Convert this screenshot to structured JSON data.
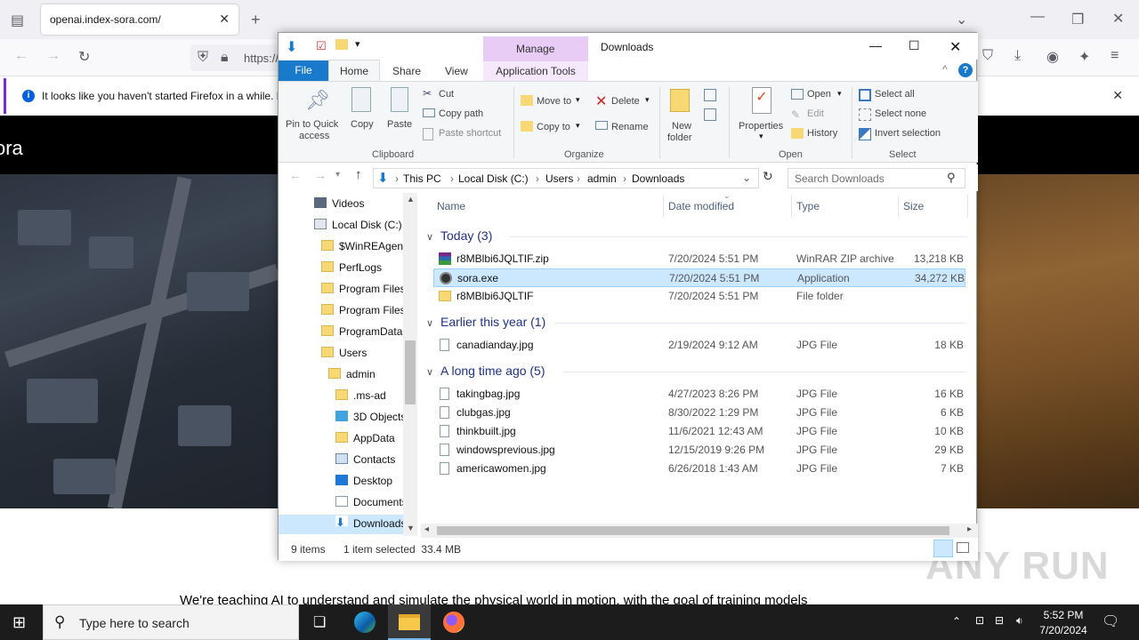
{
  "browser": {
    "tab_title": "openai.index-sora.com/",
    "url_text": "https://",
    "notification": "It looks like you haven't started Firefox in a while. D"
  },
  "page": {
    "logo": "ora",
    "body_text": "We're teaching AI to understand and simulate the physical world in motion, with the goal of training models",
    "watermark": "ANY RUN"
  },
  "explorer": {
    "window_title": "Downloads",
    "manage_label": "Manage",
    "tabs": {
      "file": "File",
      "home": "Home",
      "share": "Share",
      "view": "View",
      "app_tools": "Application Tools"
    },
    "ribbon": {
      "pin": "Pin to Quick access",
      "pin_line1": "Pin to Quick",
      "pin_line2": "access",
      "copy": "Copy",
      "paste": "Paste",
      "cut": "Cut",
      "copy_path": "Copy path",
      "paste_shortcut": "Paste shortcut",
      "move_to": "Move to",
      "copy_to": "Copy to",
      "delete": "Delete",
      "rename": "Rename",
      "new_folder_line1": "New",
      "new_folder_line2": "folder",
      "properties": "Properties",
      "open": "Open",
      "edit": "Edit",
      "history": "History",
      "select_all": "Select all",
      "select_none": "Select none",
      "invert_selection": "Invert selection",
      "groups": {
        "clipboard": "Clipboard",
        "organize": "Organize",
        "open": "Open",
        "select": "Select"
      }
    },
    "address": [
      "This PC",
      "Local Disk (C:)",
      "Users",
      "admin",
      "Downloads"
    ],
    "search_placeholder": "Search Downloads",
    "nav_items": [
      {
        "label": "Videos",
        "icon": "videos-icon"
      },
      {
        "label": "Local Disk (C:)",
        "icon": "drive-icon"
      },
      {
        "label": "$WinREAgent",
        "icon": "folder-icon"
      },
      {
        "label": "PerfLogs",
        "icon": "folder-icon"
      },
      {
        "label": "Program Files",
        "icon": "folder-icon"
      },
      {
        "label": "Program Files",
        "icon": "folder-icon"
      },
      {
        "label": "ProgramData",
        "icon": "folder-icon"
      },
      {
        "label": "Users",
        "icon": "folder-icon"
      },
      {
        "label": "admin",
        "icon": "folder-icon"
      },
      {
        "label": ".ms-ad",
        "icon": "folder-icon"
      },
      {
        "label": "3D Objects",
        "icon": "3d-objects-icon"
      },
      {
        "label": "AppData",
        "icon": "folder-icon"
      },
      {
        "label": "Contacts",
        "icon": "contacts-icon"
      },
      {
        "label": "Desktop",
        "icon": "desktop-icon"
      },
      {
        "label": "Documents",
        "icon": "documents-icon"
      },
      {
        "label": "Downloads",
        "icon": "downloads-icon"
      }
    ],
    "columns": {
      "name": "Name",
      "date": "Date modified",
      "type": "Type",
      "size": "Size"
    },
    "groups": [
      {
        "title": "Today (3)",
        "files": [
          {
            "name": "r8MBlbi6JQLTIF.zip",
            "date": "7/20/2024 5:51 PM",
            "type": "WinRAR ZIP archive",
            "size": "13,218 KB",
            "icon": "winrar-icon"
          },
          {
            "name": "sora.exe",
            "date": "7/20/2024 5:51 PM",
            "type": "Application",
            "size": "34,272 KB",
            "icon": "exe-icon"
          },
          {
            "name": "r8MBlbi6JQLTIF",
            "date": "7/20/2024 5:51 PM",
            "type": "File folder",
            "size": "",
            "icon": "folder-icon"
          }
        ]
      },
      {
        "title": "Earlier this year (1)",
        "files": [
          {
            "name": "canadianday.jpg",
            "date": "2/19/2024 9:12 AM",
            "type": "JPG File",
            "size": "18 KB",
            "icon": "jpg-icon"
          }
        ]
      },
      {
        "title": "A long time ago (5)",
        "files": [
          {
            "name": "takingbag.jpg",
            "date": "4/27/2023 8:26 PM",
            "type": "JPG File",
            "size": "16 KB",
            "icon": "jpg-icon"
          },
          {
            "name": "clubgas.jpg",
            "date": "8/30/2022 1:29 PM",
            "type": "JPG File",
            "size": "6 KB",
            "icon": "jpg-icon"
          },
          {
            "name": "thinkbuilt.jpg",
            "date": "11/6/2021 12:43 AM",
            "type": "JPG File",
            "size": "10 KB",
            "icon": "jpg-icon"
          },
          {
            "name": "windowsprevious.jpg",
            "date": "12/15/2019 9:26 PM",
            "type": "JPG File",
            "size": "29 KB",
            "icon": "jpg-icon"
          },
          {
            "name": "americawomen.jpg",
            "date": "6/26/2018 1:43 AM",
            "type": "JPG File",
            "size": "7 KB",
            "icon": "jpg-icon"
          }
        ]
      }
    ],
    "status": {
      "items": "9 items",
      "selected": "1 item selected  33.4 MB"
    }
  },
  "taskbar": {
    "search_placeholder": "Type here to search",
    "time": "5:52 PM",
    "date": "7/20/2024"
  },
  "colors": {
    "accent": "#1979ca",
    "selection": "#cce8ff",
    "manage": "#e9ccf5"
  }
}
